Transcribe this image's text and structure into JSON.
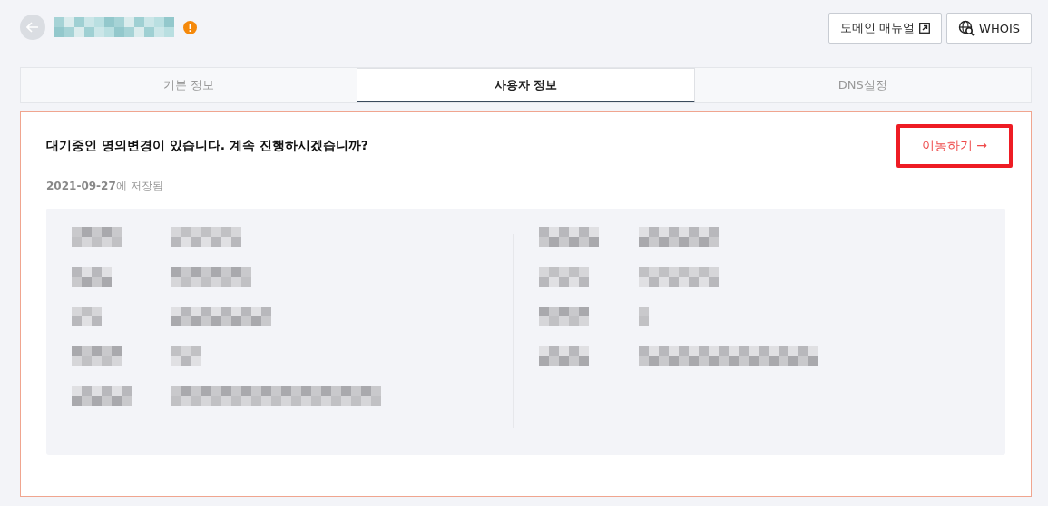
{
  "header": {
    "warning": true
  },
  "toolbar": [
    {
      "kind": "manual",
      "label": "도메인 매뉴얼"
    },
    {
      "kind": "whois",
      "label": "WHOIS"
    }
  ],
  "tabs": [
    {
      "label": "기본 정보",
      "selected": false
    },
    {
      "label": "사용자 정보",
      "selected": true
    },
    {
      "label": "DNS설정",
      "selected": false
    }
  ],
  "notice": {
    "message": "대기중인 명의변경이 있습니다. 계속 진행하시겠습니까?",
    "link": "이동하기 →",
    "saved_date": "2021-09-27",
    "saved_suffix": "에 저장됨"
  }
}
